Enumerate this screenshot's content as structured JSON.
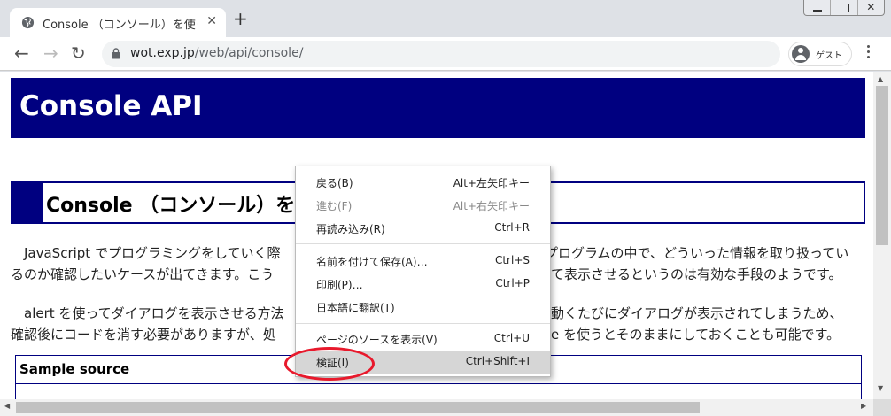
{
  "browser": {
    "tab_title": "Console （コンソール）を使っ",
    "tab_close": "✕",
    "new_tab": "+",
    "url_host": "wot.exp.jp",
    "url_path": "/web/api/console/",
    "profile_label": "ゲスト",
    "back": "←",
    "forward": "→",
    "reload": "↻",
    "window_close": "✕"
  },
  "page": {
    "h1": "Console API",
    "h2": "Console （コンソール）を",
    "para1_line1": "　JavaScript でプログラミングをしていく際",
    "para1_line1b": "プログラムの中で、どういった情報を取り扱ってい",
    "para1_line2": "るのか確認したいケースが出てきます。こう",
    "para1_line2b": "て表示させるというのは有効な手段のようです。",
    "para2_line1": "　alert を使ってダイアログを表示させる方法",
    "para2_line1b": "動くたびにダイアログが表示されてしまうため、",
    "para2_line2": "確認後にコードを消す必要がありますが、処",
    "para2_line2b": "e を使うとそのままにしておくことも可能です。",
    "sample_heading": "Sample source"
  },
  "context_menu": {
    "items": [
      {
        "label": "戻る(B)",
        "shortcut": "Alt+左矢印キー",
        "disabled": false
      },
      {
        "label": "進む(F)",
        "shortcut": "Alt+右矢印キー",
        "disabled": true
      },
      {
        "label": "再読み込み(R)",
        "shortcut": "Ctrl+R",
        "disabled": false
      },
      {
        "label": "名前を付けて保存(A)…",
        "shortcut": "Ctrl+S",
        "disabled": false
      },
      {
        "label": "印刷(P)…",
        "shortcut": "Ctrl+P",
        "disabled": false
      },
      {
        "label": "日本語に翻訳(T)",
        "shortcut": "",
        "disabled": false
      },
      {
        "label": "ページのソースを表示(V)",
        "shortcut": "Ctrl+U",
        "disabled": false
      },
      {
        "label": "検証(I)",
        "shortcut": "Ctrl+Shift+I",
        "disabled": false
      }
    ]
  },
  "colors": {
    "header_bg": "#000080",
    "highlight_circle": "#e8192c"
  }
}
